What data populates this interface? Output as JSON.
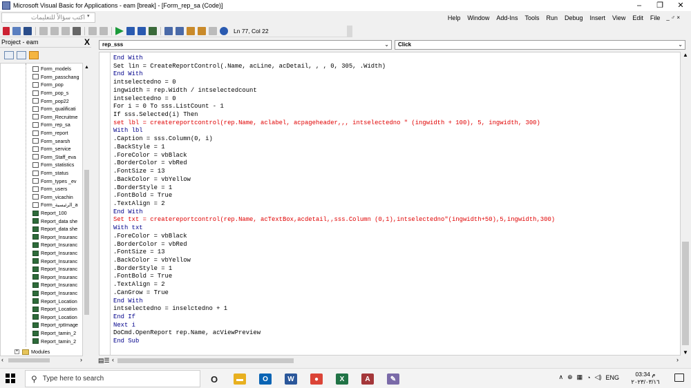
{
  "window": {
    "title": "Microsoft Visual Basic for Applications - eam [break] - [Form_rep_sa (Code)]",
    "controls": {
      "minimize": "–",
      "restore": "❐",
      "close": "✕"
    }
  },
  "menubar": {
    "ask_placeholder": "اكتب سؤالاً للتعليمات",
    "items": [
      "Help",
      "Window",
      "Add-Ins",
      "Tools",
      "Run",
      "Debug",
      "Insert",
      "View",
      "Edit",
      "File"
    ],
    "doc_controls": "_ ♂ ×"
  },
  "toolbar": {
    "position": "Ln 77, Col 22"
  },
  "project": {
    "title": "Project - eam",
    "close": "X",
    "items": [
      {
        "name": "Form_models",
        "type": "form"
      },
      {
        "name": "Form_passchang",
        "type": "form"
      },
      {
        "name": "Form_pop",
        "type": "form"
      },
      {
        "name": "Form_pop_s",
        "type": "form"
      },
      {
        "name": "Form_pop22",
        "type": "form"
      },
      {
        "name": "Form_qualificati",
        "type": "form"
      },
      {
        "name": "Form_Recruitme",
        "type": "form"
      },
      {
        "name": "Form_rep_sa",
        "type": "form"
      },
      {
        "name": "Form_report",
        "type": "form"
      },
      {
        "name": "Form_searsh",
        "type": "form"
      },
      {
        "name": "Form_service",
        "type": "form"
      },
      {
        "name": "Form_Staff_eva",
        "type": "form"
      },
      {
        "name": "Form_statistics",
        "type": "form"
      },
      {
        "name": "Form_status",
        "type": "form"
      },
      {
        "name": "Form_types _ev",
        "type": "form"
      },
      {
        "name": "Form_users",
        "type": "form"
      },
      {
        "name": "Form_vicachin",
        "type": "form"
      },
      {
        "name": "Form_الرئيسية_a",
        "type": "form"
      },
      {
        "name": "Report_100",
        "type": "report"
      },
      {
        "name": "Report_data she",
        "type": "report"
      },
      {
        "name": "Report_data she",
        "type": "report"
      },
      {
        "name": "Report_Insuranc",
        "type": "report"
      },
      {
        "name": "Report_Insuranc",
        "type": "report"
      },
      {
        "name": "Report_Insuranc",
        "type": "report"
      },
      {
        "name": "Report_Insuranc",
        "type": "report"
      },
      {
        "name": "Report_Insuranc",
        "type": "report"
      },
      {
        "name": "Report_Insuranc",
        "type": "report"
      },
      {
        "name": "Report_Insuranc",
        "type": "report"
      },
      {
        "name": "Report_Insuranc",
        "type": "report"
      },
      {
        "name": "Report_Location",
        "type": "report"
      },
      {
        "name": "Report_Location",
        "type": "report"
      },
      {
        "name": "Report_Location",
        "type": "report"
      },
      {
        "name": "Report_rptImage",
        "type": "report"
      },
      {
        "name": "Report_tamin_2",
        "type": "report"
      },
      {
        "name": "Report_tamin_2",
        "type": "report"
      }
    ],
    "modules_label": "Modules"
  },
  "code": {
    "object_combo": "rep_sss",
    "proc_combo": "Click",
    "lines": [
      {
        "text": "End With",
        "style": "kw"
      },
      {
        "text": "Set lin = CreateReportControl(.Name, acLine, acDetail, , , 0, 305, .Width)",
        "style": "plain"
      },
      {
        "text": "End With",
        "style": "kw"
      },
      {
        "text": "intselectedno = 0",
        "style": "plain"
      },
      {
        "text": "ingwidth = rep.Width / intselectedcount",
        "style": "plain"
      },
      {
        "text": "intselectedno = 0",
        "style": "plain"
      },
      {
        "text": "For i = 0 To sss.ListCount - 1",
        "style": "plain"
      },
      {
        "text": "If sss.Selected(i) Then",
        "style": "plain"
      },
      {
        "text": "set lbl = createreportcontrol(rep.Name, aclabel, acpageheader,,, intselectedno \" (ingwidth + 100), 5, ingwidth, 300)",
        "style": "err"
      },
      {
        "text": "With lbl",
        "style": "kw"
      },
      {
        "text": ".Caption = sss.Column(0, i)",
        "style": "plain"
      },
      {
        "text": ".BackStyle = 1",
        "style": "plain"
      },
      {
        "text": ".ForeColor = vbBlack",
        "style": "plain"
      },
      {
        "text": ".BorderColor = vbRed",
        "style": "plain"
      },
      {
        "text": ".FontSize = 13",
        "style": "plain"
      },
      {
        "text": ".BackColor = vbYellow",
        "style": "plain"
      },
      {
        "text": ".BorderStyle = 1",
        "style": "plain"
      },
      {
        "text": ".FontBold = True",
        "style": "plain"
      },
      {
        "text": ".TextAlign = 2",
        "style": "plain"
      },
      {
        "text": "End With",
        "style": "kw"
      },
      {
        "text": "Set txt = createreportcontrol(rep.Name, acTextBox,acdetail,,sss.Column (0,1),intselectedno\"(ingwidth+50),5,ingwidth,300)",
        "style": "err"
      },
      {
        "text": "With txt",
        "style": "kw"
      },
      {
        "text": ".ForeColor = vbBlack",
        "style": "plain"
      },
      {
        "text": ".BorderColor = vbRed",
        "style": "plain"
      },
      {
        "text": ".FontSize = 13",
        "style": "plain"
      },
      {
        "text": ".BackColor = vbYellow",
        "style": "plain"
      },
      {
        "text": ".BorderStyle = 1",
        "style": "plain"
      },
      {
        "text": ".FontBold = True",
        "style": "plain"
      },
      {
        "text": ".TextAlign = 2",
        "style": "plain"
      },
      {
        "text": ".CanGrow = True",
        "style": "plain"
      },
      {
        "text": "End With",
        "style": "kw"
      },
      {
        "text": "intselectedno = inselctedno + 1",
        "style": "plain"
      },
      {
        "text": "End If",
        "style": "kw"
      },
      {
        "text": "Next i",
        "style": "kw"
      },
      {
        "text": "DoCmd.OpenReport rep.Name, acViewPreview",
        "style": "plain"
      },
      {
        "text": "End Sub",
        "style": "kw"
      }
    ]
  },
  "taskbar": {
    "search_placeholder": "Type here to search",
    "language": "ENG",
    "time": "03:34 م",
    "date": "٢٠٢٣/٠٣/١٦",
    "apps": [
      {
        "name": "task-view",
        "glyph": "O",
        "color": "#222222"
      },
      {
        "name": "file-explorer",
        "glyph": "▬",
        "color": "#e8b020"
      },
      {
        "name": "outlook",
        "glyph": "O",
        "color": "#0a64b4"
      },
      {
        "name": "word",
        "glyph": "W",
        "color": "#2b579a"
      },
      {
        "name": "chrome",
        "glyph": "●",
        "color": "#db4437"
      },
      {
        "name": "excel",
        "glyph": "X",
        "color": "#217346"
      },
      {
        "name": "access",
        "glyph": "A",
        "color": "#a4373a"
      },
      {
        "name": "paint",
        "glyph": "✎",
        "color": "#7a6aa8"
      }
    ]
  },
  "colors": {
    "keyword": "#00008b",
    "error": "#e00000"
  }
}
